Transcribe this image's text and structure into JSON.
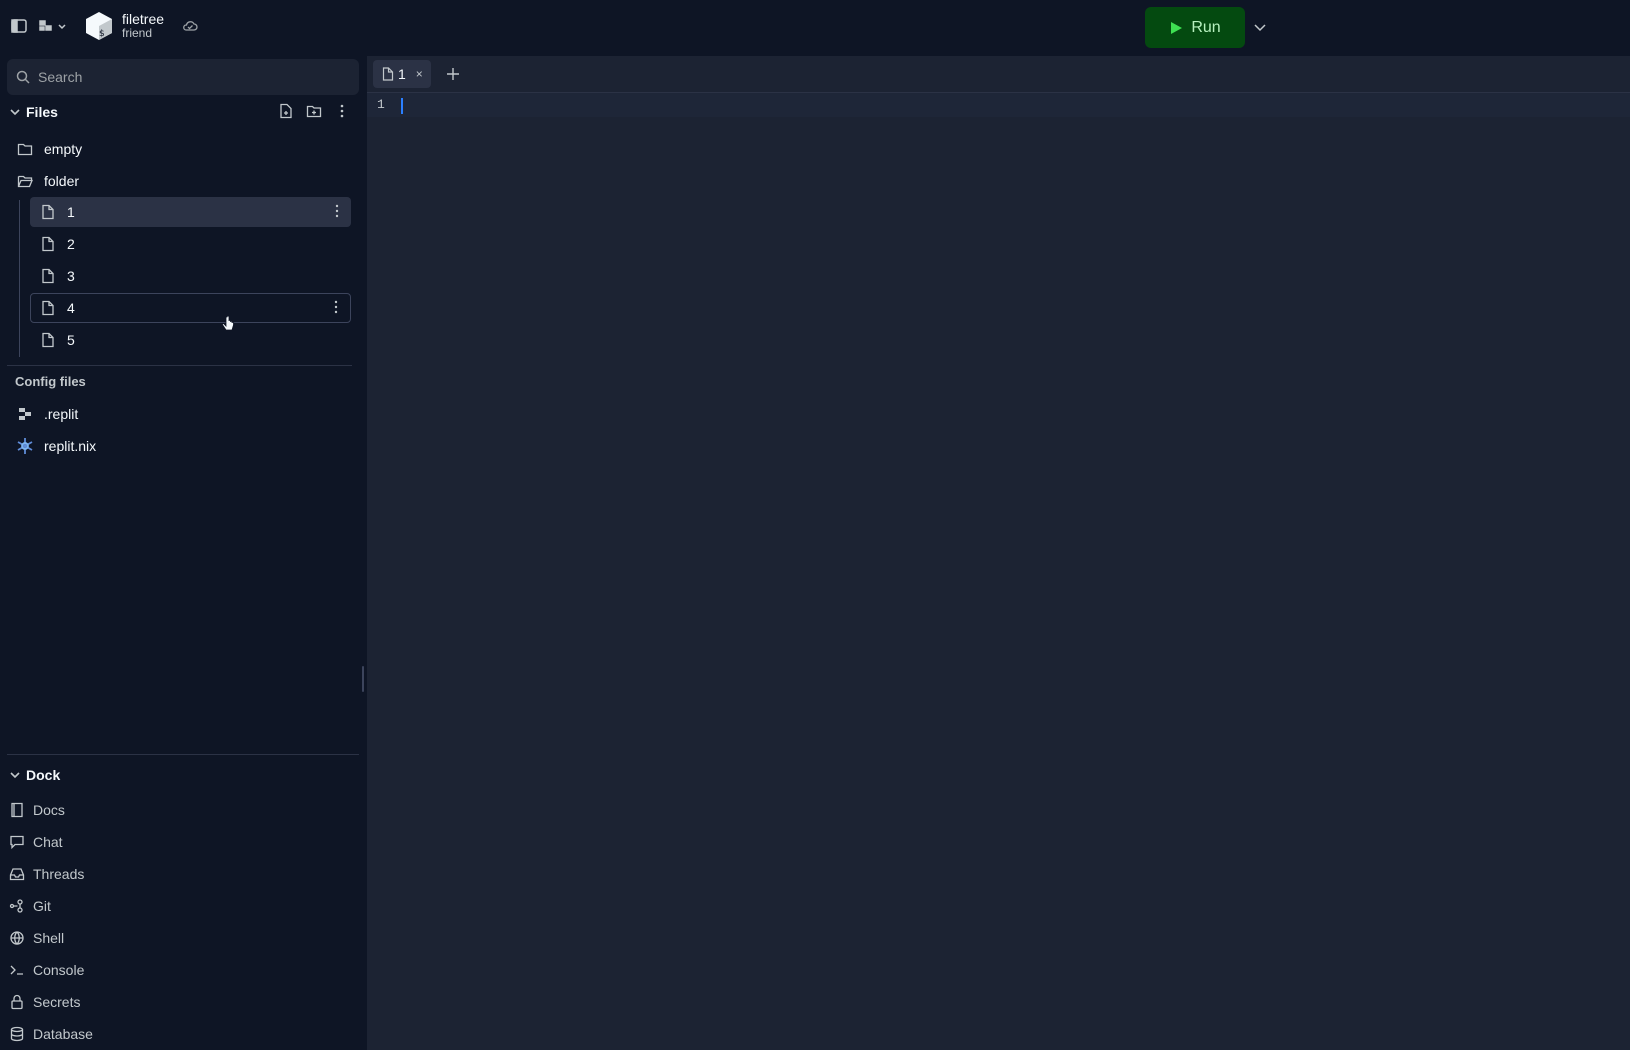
{
  "topbar": {
    "app_name": "filetree",
    "app_sub": "friend",
    "run_label": "Run"
  },
  "search": {
    "placeholder": "Search"
  },
  "files": {
    "title": "Files",
    "items": [
      {
        "label": "empty",
        "type": "folder"
      },
      {
        "label": "folder",
        "type": "folder-open"
      }
    ],
    "children": [
      {
        "label": "1",
        "state": "selected"
      },
      {
        "label": "2"
      },
      {
        "label": "3"
      },
      {
        "label": "4",
        "state": "hover"
      },
      {
        "label": "5"
      }
    ]
  },
  "config": {
    "title": "Config files",
    "items": [
      {
        "label": ".replit"
      },
      {
        "label": "replit.nix"
      }
    ]
  },
  "dock": {
    "title": "Dock",
    "items": [
      {
        "label": "Docs",
        "icon": "book-icon"
      },
      {
        "label": "Chat",
        "icon": "chat-icon"
      },
      {
        "label": "Threads",
        "icon": "threads-icon"
      },
      {
        "label": "Git",
        "icon": "git-icon"
      },
      {
        "label": "Shell",
        "icon": "shell-icon"
      },
      {
        "label": "Console",
        "icon": "console-icon"
      },
      {
        "label": "Secrets",
        "icon": "lock-icon"
      },
      {
        "label": "Database",
        "icon": "database-icon"
      }
    ]
  },
  "editor": {
    "tab_label": "1",
    "tab_close": "×",
    "line_number": "1"
  }
}
